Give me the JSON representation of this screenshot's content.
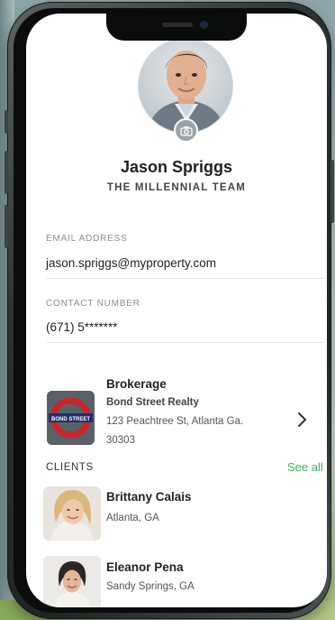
{
  "profile": {
    "name": "Jason Spriggs",
    "team": "THE MILLENNIAL TEAM"
  },
  "fields": {
    "email_label": "EMAIL ADDRESS",
    "email_value": "jason.spriggs@myproperty.com",
    "contact_label": "CONTACT NUMBER",
    "contact_value": "(671) 5*******"
  },
  "brokerage": {
    "title": "Brokerage",
    "name": "Bond Street Realty",
    "address_line1": "123 Peachtree St, Atlanta Ga.",
    "address_line2": "30303",
    "logo_text": "BOND STREET"
  },
  "clients": {
    "label": "CLIENTS",
    "see_all": "See all",
    "items": [
      {
        "name": "Brittany Calais",
        "location": "Atlanta, GA"
      },
      {
        "name": "Eleanor Pena",
        "location": "Sandy Springs, GA"
      }
    ]
  },
  "colors": {
    "accent_green": "#3fb45a",
    "logo_red": "#c8262c",
    "logo_blue": "#1e2f6e"
  },
  "icons": {
    "camera": "camera-icon",
    "chevron": "chevron-right-icon"
  }
}
